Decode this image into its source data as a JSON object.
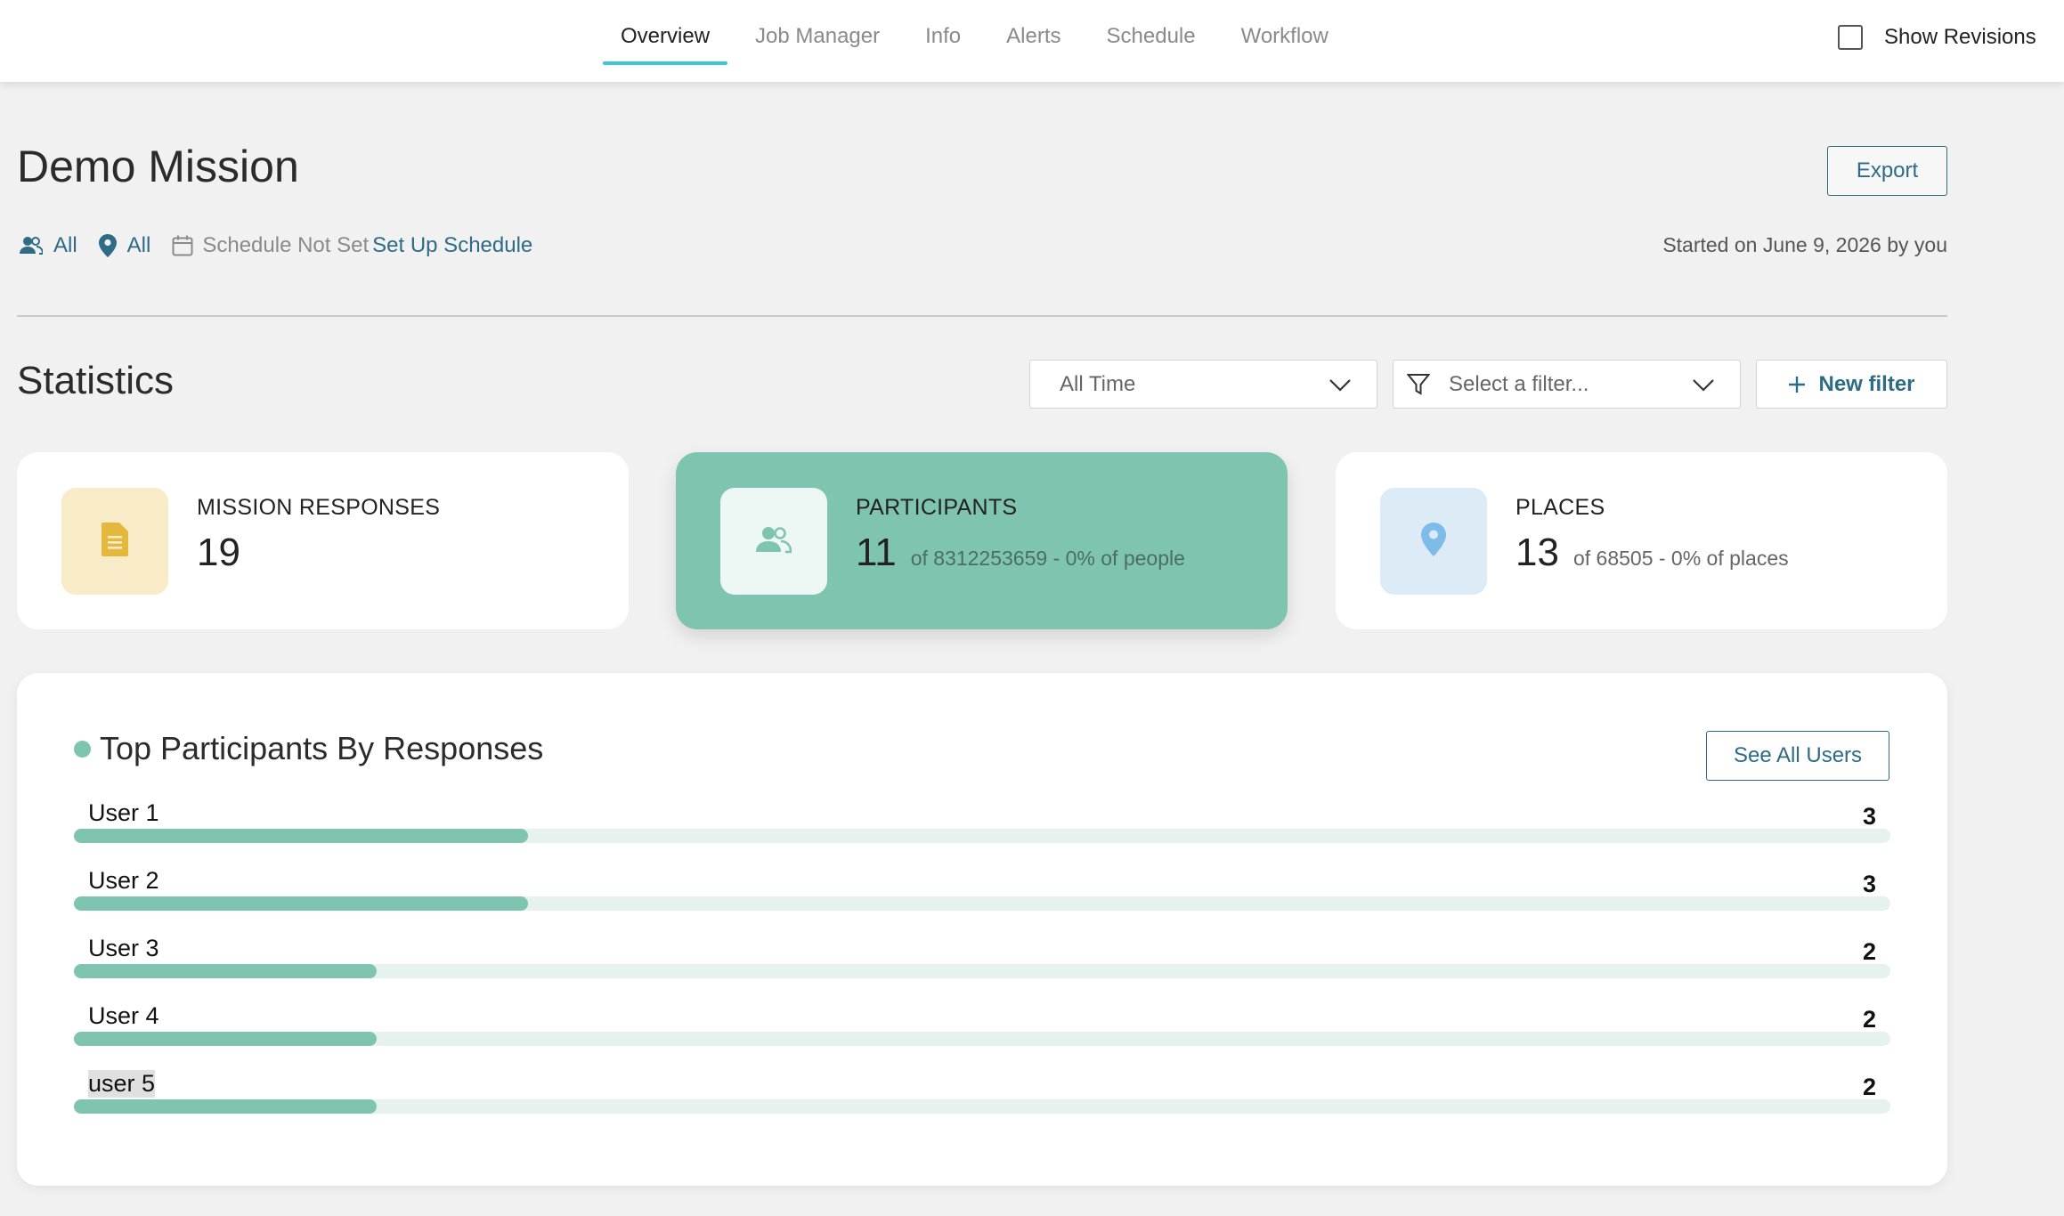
{
  "nav": {
    "tabs": [
      {
        "label": "Overview",
        "active": true
      },
      {
        "label": "Job Manager",
        "active": false
      },
      {
        "label": "Info",
        "active": false
      },
      {
        "label": "Alerts",
        "active": false
      },
      {
        "label": "Schedule",
        "active": false
      },
      {
        "label": "Workflow",
        "active": false
      }
    ],
    "show_revisions": {
      "label": "Show Revisions",
      "checked": false
    }
  },
  "header": {
    "title": "Demo Mission",
    "export_label": "Export",
    "people_filter": "All",
    "places_filter": "All",
    "schedule_status": "Schedule Not Set",
    "schedule_link": "Set Up Schedule",
    "started": "Started on June 9, 2026 by you"
  },
  "statistics": {
    "title": "Statistics",
    "time_select": "All Time",
    "filter_placeholder": "Select a filter...",
    "new_filter_label": "New filter",
    "cards": [
      {
        "label": "MISSION RESPONSES",
        "value": "19",
        "sub": "",
        "icon": "document-icon",
        "active": false
      },
      {
        "label": "PARTICIPANTS",
        "value": "11",
        "sub": "of 8312253659 - 0% of people",
        "icon": "people-icon",
        "active": true
      },
      {
        "label": "PLACES",
        "value": "13",
        "sub": "of 68505 - 0% of places",
        "icon": "location-pin-icon",
        "active": false
      }
    ]
  },
  "top_participants": {
    "title": "Top Participants By Responses",
    "see_all_label": "See All Users",
    "max_scale": 12,
    "users": [
      {
        "name": "User 1",
        "count": 3
      },
      {
        "name": "User 2",
        "count": 3
      },
      {
        "name": "User 3",
        "count": 2
      },
      {
        "name": "User 4",
        "count": 2
      },
      {
        "name": "user 5",
        "count": 2
      }
    ]
  },
  "colors": {
    "accent_teal": "#7fc4b0",
    "tab_underline": "#3fc6d6",
    "link_blue": "#2d6b86",
    "doc_icon": "#e3b83c",
    "pin_icon": "#7dbbe8"
  }
}
